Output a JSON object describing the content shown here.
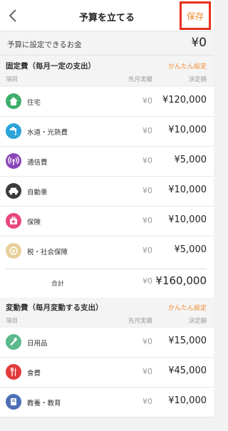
{
  "header": {
    "title": "予算を立てる",
    "save_label": "保存"
  },
  "available": {
    "label": "予算に設定できるお金",
    "value": "¥0"
  },
  "fixed_section": {
    "title": "固定費（毎月一定の支出）",
    "easy_setting": "かんたん設定",
    "col_item": "項目",
    "col_prev": "先月実績",
    "col_budget": "決定額",
    "items": [
      {
        "icon": "house-icon",
        "color": "#3fae6c",
        "label": "住宅",
        "prev": "¥0",
        "amount": "¥120,000"
      },
      {
        "icon": "faucet-icon",
        "color": "#2ba4d9",
        "label": "水道・光熱費",
        "prev": "¥0",
        "amount": "¥10,000"
      },
      {
        "icon": "signal-icon",
        "color": "#8a46b8",
        "label": "通信費",
        "prev": "¥0",
        "amount": "¥5,000"
      },
      {
        "icon": "car-icon",
        "color": "#3a3a3a",
        "label": "自動車",
        "prev": "¥0",
        "amount": "¥10,000"
      },
      {
        "icon": "insurance-icon",
        "color": "#e9477d",
        "label": "保険",
        "prev": "¥0",
        "amount": "¥10,000"
      },
      {
        "icon": "tax-icon",
        "color": "#e8cf9a",
        "label": "税・社会保障",
        "prev": "¥0",
        "amount": "¥5,000"
      }
    ],
    "total": {
      "label": "合計",
      "prev": "¥0",
      "amount": "¥160,000"
    }
  },
  "variable_section": {
    "title": "変動費（毎月変動する支出）",
    "easy_setting": "かんたん設定",
    "col_item": "項目",
    "col_prev": "先月実績",
    "col_budget": "決定額",
    "items": [
      {
        "icon": "toothbrush-icon",
        "color": "#5bb98c",
        "label": "日用品",
        "prev": "¥0",
        "amount": "¥15,000"
      },
      {
        "icon": "fork-knife-icon",
        "color": "#e23b3b",
        "label": "食費",
        "prev": "¥0",
        "amount": "¥45,000"
      },
      {
        "icon": "book-icon",
        "color": "#4d6fb5",
        "label": "教養・教育",
        "prev": "¥0",
        "amount": "¥10,000"
      }
    ]
  }
}
